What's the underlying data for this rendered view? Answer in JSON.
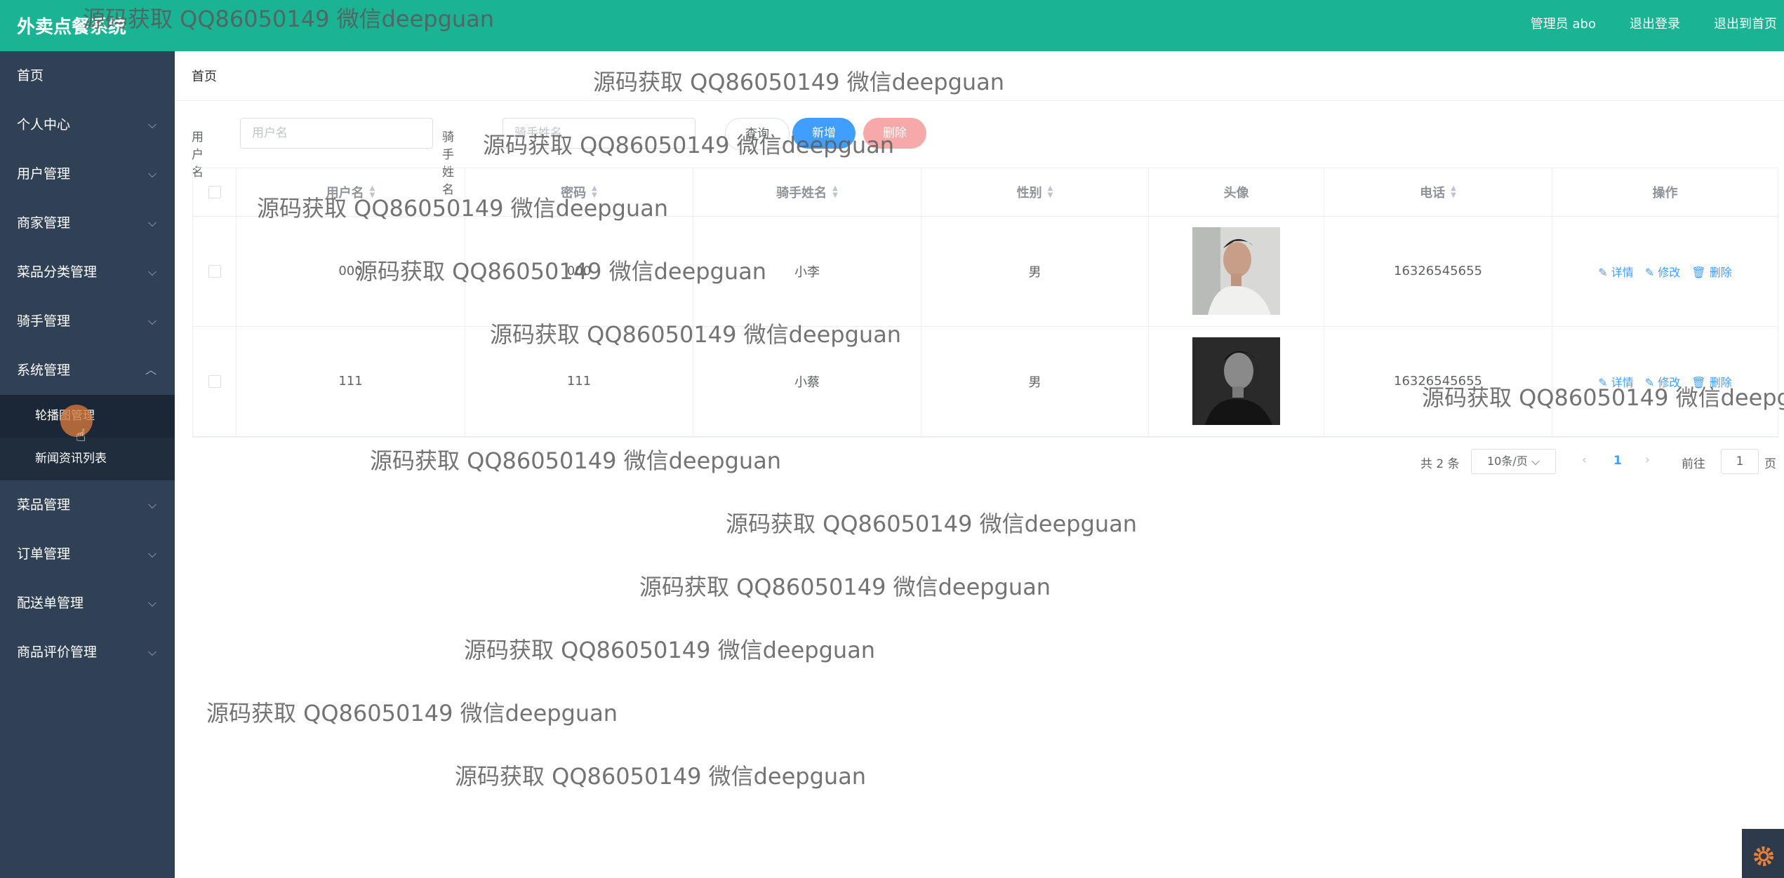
{
  "app": {
    "title": "外卖点餐系统"
  },
  "topnav": {
    "user": "管理员 abo",
    "logout": "退出登录",
    "home": "退出到首页"
  },
  "sidebar": {
    "items": [
      {
        "label": "首页"
      },
      {
        "label": "个人中心",
        "chevron": "chevron-down-icon"
      },
      {
        "label": "用户管理",
        "chevron": "chevron-down-icon"
      },
      {
        "label": "商家管理",
        "chevron": "chevron-down-icon"
      },
      {
        "label": "菜品分类管理",
        "chevron": "chevron-down-icon"
      },
      {
        "label": "骑手管理",
        "chevron": "chevron-down-icon"
      },
      {
        "label": "系统管理",
        "chevron": "chevron-up-icon"
      },
      {
        "label": "菜品管理",
        "chevron": "chevron-down-icon"
      },
      {
        "label": "订单管理",
        "chevron": "chevron-down-icon"
      },
      {
        "label": "配送单管理",
        "chevron": "chevron-down-icon"
      },
      {
        "label": "商品评价管理",
        "chevron": "chevron-down-icon"
      }
    ],
    "subitems": [
      {
        "label": "轮播图管理"
      },
      {
        "label": "新闻资讯列表"
      }
    ]
  },
  "breadcrumb": {
    "home": "首页"
  },
  "search": {
    "username_label": "用户名",
    "username_placeholder": "用户名",
    "rider_label": "骑手姓名",
    "rider_placeholder": "骑手姓名",
    "query": "查询",
    "add": "新增",
    "delete": "删除"
  },
  "table": {
    "headers": {
      "username": "用户名",
      "password": "密码",
      "rider_name": "骑手姓名",
      "gender": "性别",
      "avatar": "头像",
      "phone": "电话",
      "actions": "操作"
    },
    "rows": [
      {
        "username": "000",
        "password": "000",
        "rider_name": "小李",
        "gender": "男",
        "phone": "16326545655"
      },
      {
        "username": "111",
        "password": "111",
        "rider_name": "小蔡",
        "gender": "男",
        "phone": "16326545655"
      }
    ],
    "action_labels": {
      "detail": "详情",
      "edit": "修改",
      "delete": "删除"
    }
  },
  "pagination": {
    "total": "共 2 条",
    "page_size": "10条/页",
    "current_page": "1",
    "goto_label": "前往",
    "goto_value": "1",
    "page_unit": "页"
  },
  "watermark": "源码获取 QQ86050149 微信deepguan",
  "colors": {
    "topbar": "#1ab394",
    "sidebar": "#304156",
    "primary": "#409eff",
    "danger_light": "#f7a8a8"
  }
}
